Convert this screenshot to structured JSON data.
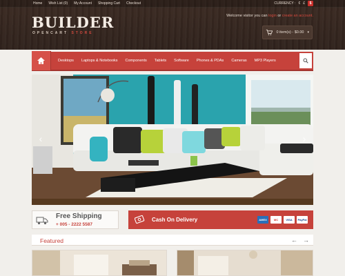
{
  "topbar": {
    "links": [
      "Home",
      "Wish List (0)",
      "My Account",
      "Shopping Cart",
      "Checkout"
    ],
    "currency_label": "CURRENCY :",
    "currencies": [
      "€",
      "£",
      "$"
    ]
  },
  "logo": {
    "title": "BUILDER",
    "sub_main": "OPENCART",
    "sub_accent": "STORE"
  },
  "welcome": {
    "prefix": "Welcome visitor you can",
    "login": "login",
    "or": "or",
    "register": "create an account."
  },
  "cart": {
    "label": "0 item(s) - $0.00"
  },
  "nav": {
    "items": [
      "Desktops",
      "Laptops & Notebooks",
      "Components",
      "Tablets",
      "Software",
      "Phones & PDAs",
      "Cameras",
      "MP3 Players"
    ]
  },
  "promo": {
    "shipping_title": "Free Shipping",
    "shipping_phone": "+ 005 - 2222 5587",
    "cod_title": "Cash On Delivery",
    "cards": [
      "AMEX",
      "MC",
      "VISA",
      "PayPal"
    ]
  },
  "featured": {
    "title": "Featured"
  },
  "icons": [
    "home-icon",
    "search-icon",
    "cart-icon",
    "truck-icon",
    "cash-icon",
    "arrow-left-icon",
    "arrow-right-icon"
  ],
  "colors": {
    "accent": "#c6423b",
    "header": "#3b2a22",
    "hero_wall": "#2fa7b0"
  }
}
